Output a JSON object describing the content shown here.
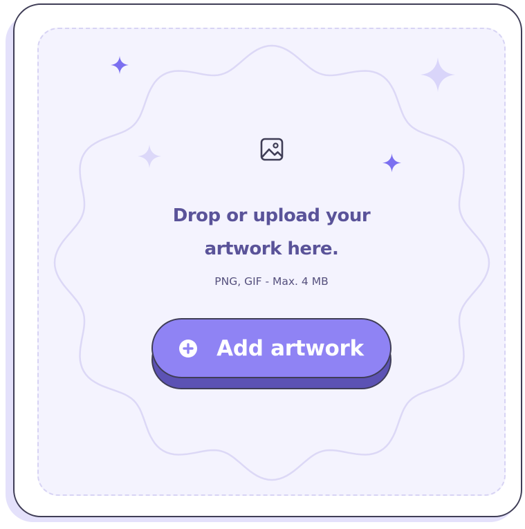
{
  "upload": {
    "title_line1": "Drop or upload your",
    "title_line2": "artwork here.",
    "hint": "PNG, GIF - Max. 4 MB",
    "button_label": "Add artwork",
    "button_icon": "plus-circle-icon",
    "main_icon": "image-icon"
  },
  "colors": {
    "accent": "#8f83f4",
    "accent_dark": "#5c52b4",
    "outline": "#3f3d56",
    "title": "#5a5399",
    "dropzone_bg": "#f4f3fe",
    "sparkle": "#7b6ff0",
    "sparkle_light": "#d9d5fa"
  }
}
